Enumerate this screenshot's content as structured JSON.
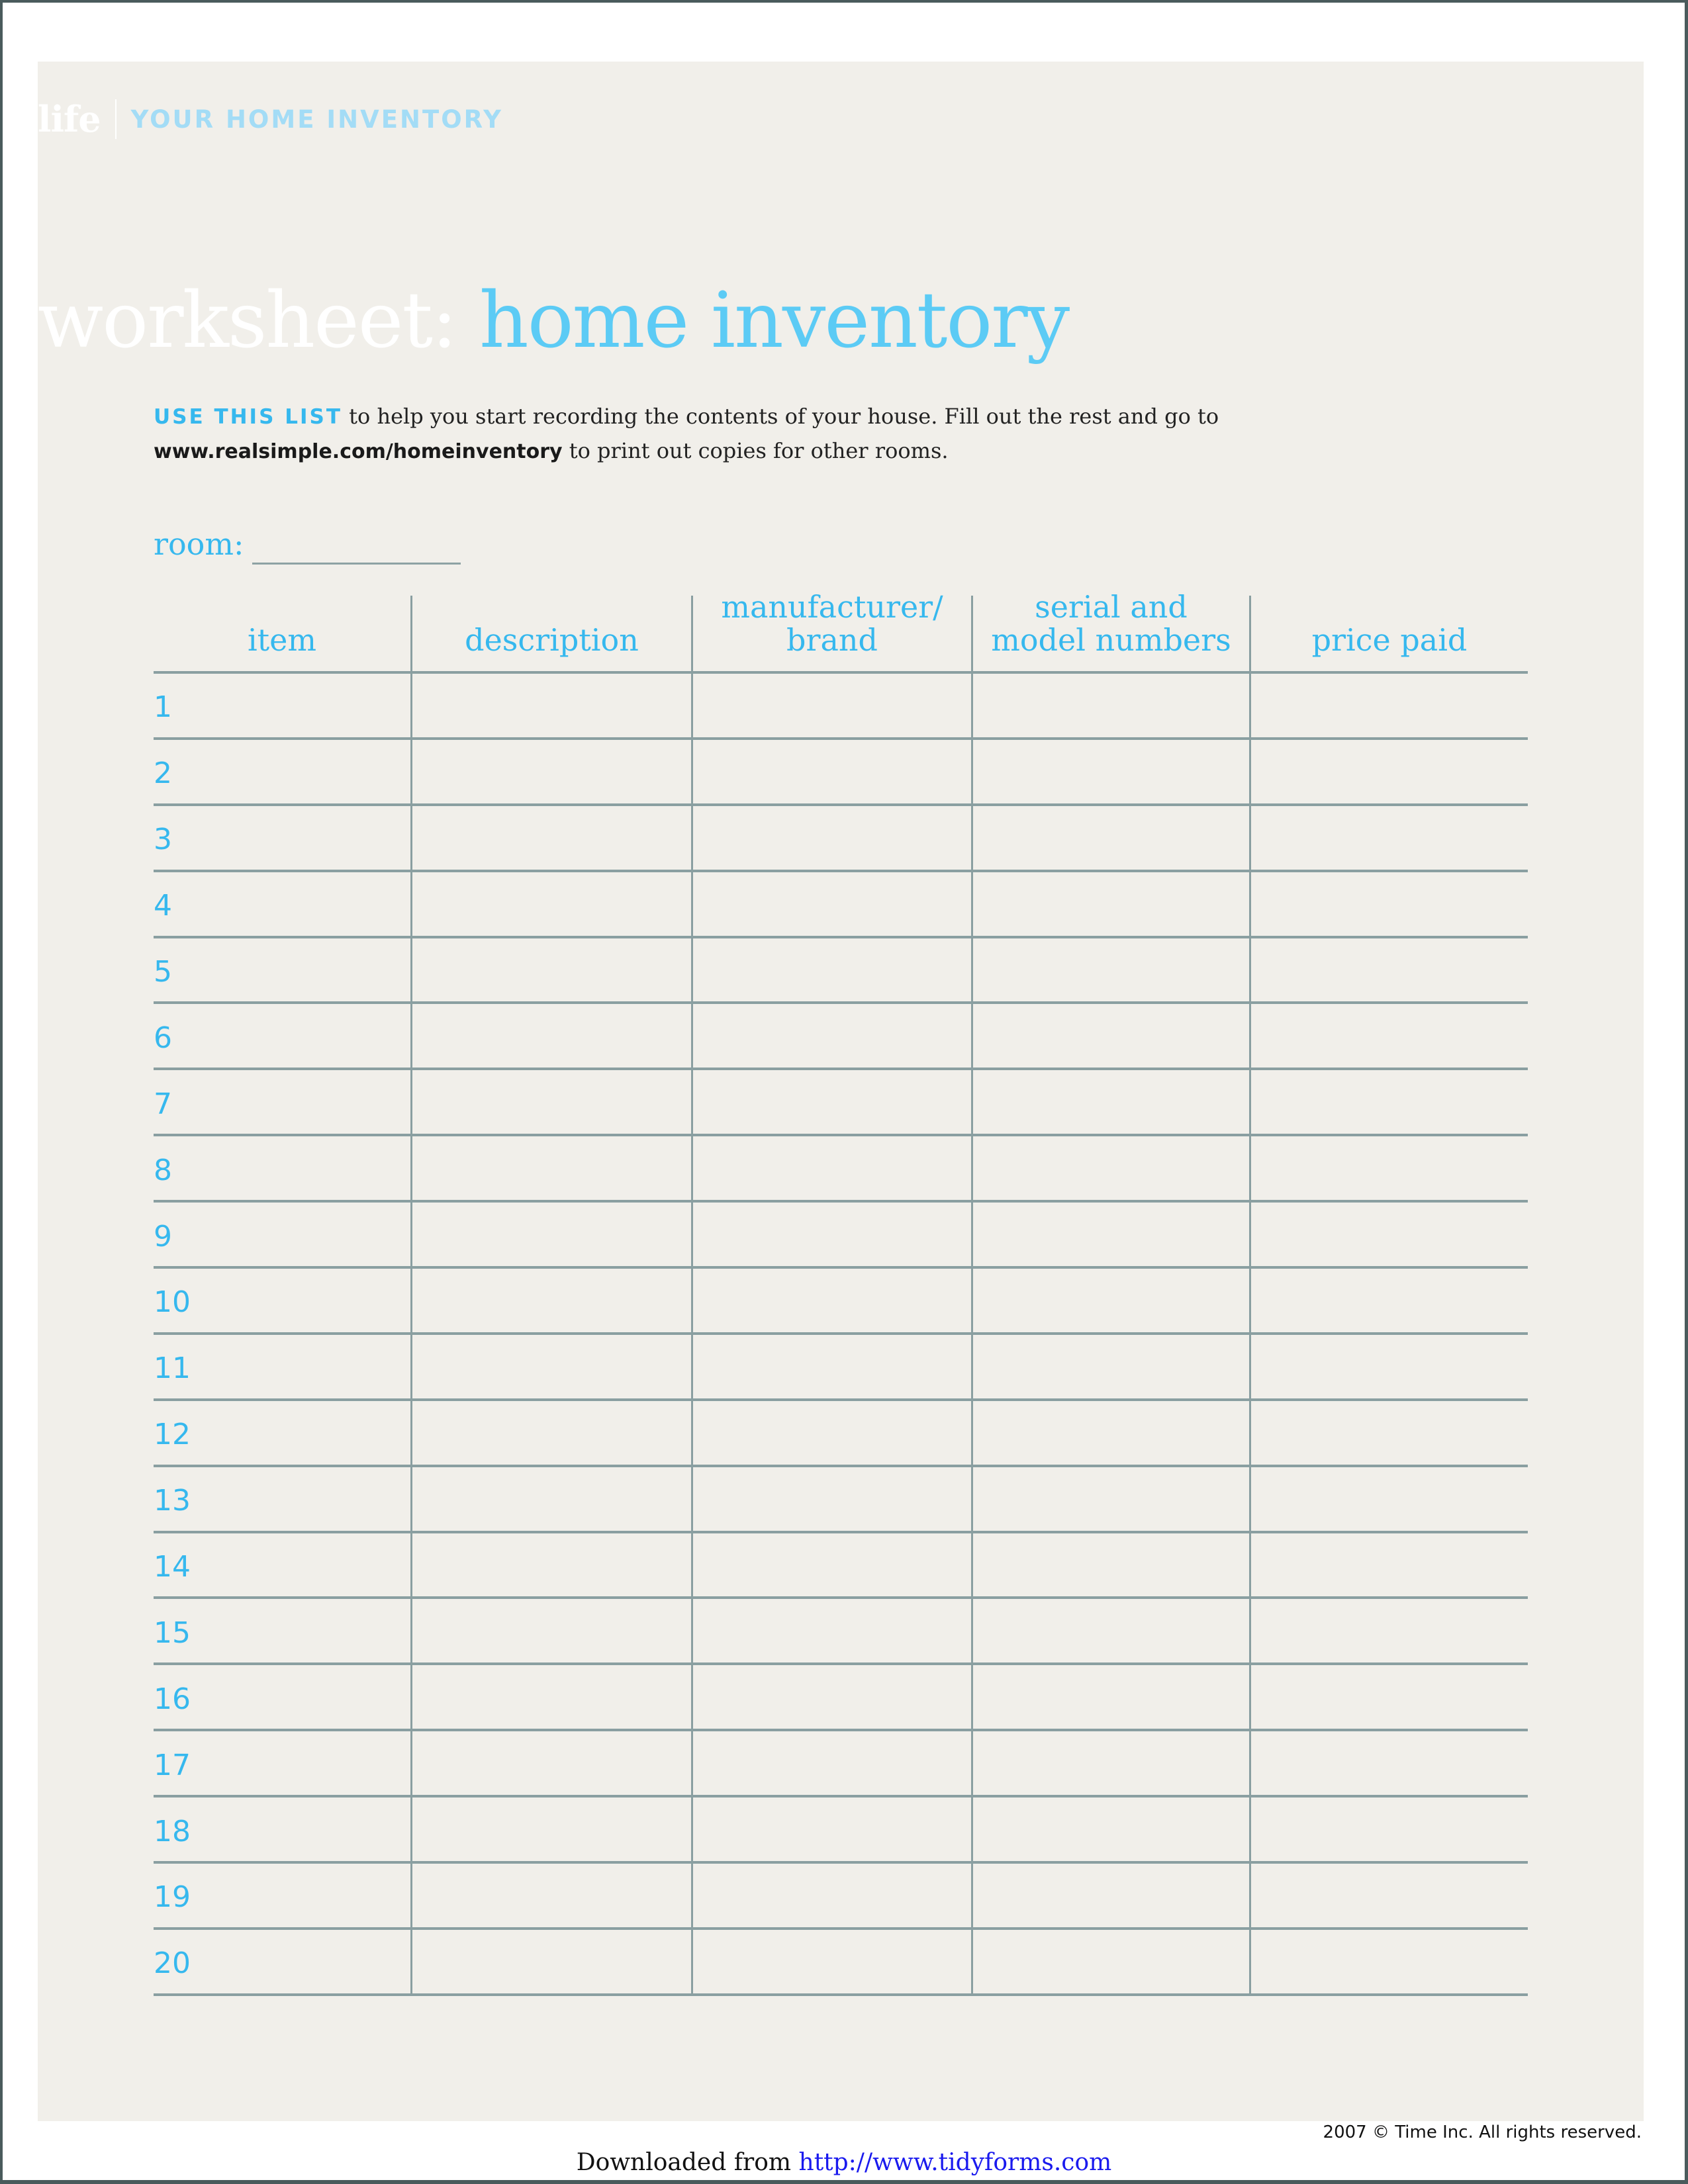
{
  "header": {
    "brand": "life",
    "section": "YOUR HOME INVENTORY"
  },
  "title": {
    "prefix": "worksheet:",
    "main": "home inventory"
  },
  "intro": {
    "lead": "USE THIS LIST",
    "text_before_url": " to help you start recording the contents of your house. Fill out the rest and go to ",
    "url": "www.realsimple.com/homeinventory",
    "text_after_url": " to print out copies for other rooms."
  },
  "room": {
    "label": "room:",
    "value": ""
  },
  "table": {
    "columns": [
      "item",
      "description",
      "manufacturer/\nbrand",
      "serial and\nmodel numbers",
      "price paid"
    ],
    "rows": [
      {
        "number": "1",
        "description": "",
        "manufacturer": "",
        "serial": "",
        "price": ""
      },
      {
        "number": "2",
        "description": "",
        "manufacturer": "",
        "serial": "",
        "price": ""
      },
      {
        "number": "3",
        "description": "",
        "manufacturer": "",
        "serial": "",
        "price": ""
      },
      {
        "number": "4",
        "description": "",
        "manufacturer": "",
        "serial": "",
        "price": ""
      },
      {
        "number": "5",
        "description": "",
        "manufacturer": "",
        "serial": "",
        "price": ""
      },
      {
        "number": "6",
        "description": "",
        "manufacturer": "",
        "serial": "",
        "price": ""
      },
      {
        "number": "7",
        "description": "",
        "manufacturer": "",
        "serial": "",
        "price": ""
      },
      {
        "number": "8",
        "description": "",
        "manufacturer": "",
        "serial": "",
        "price": ""
      },
      {
        "number": "9",
        "description": "",
        "manufacturer": "",
        "serial": "",
        "price": ""
      },
      {
        "number": "10",
        "description": "",
        "manufacturer": "",
        "serial": "",
        "price": ""
      },
      {
        "number": "11",
        "description": "",
        "manufacturer": "",
        "serial": "",
        "price": ""
      },
      {
        "number": "12",
        "description": "",
        "manufacturer": "",
        "serial": "",
        "price": ""
      },
      {
        "number": "13",
        "description": "",
        "manufacturer": "",
        "serial": "",
        "price": ""
      },
      {
        "number": "14",
        "description": "",
        "manufacturer": "",
        "serial": "",
        "price": ""
      },
      {
        "number": "15",
        "description": "",
        "manufacturer": "",
        "serial": "",
        "price": ""
      },
      {
        "number": "16",
        "description": "",
        "manufacturer": "",
        "serial": "",
        "price": ""
      },
      {
        "number": "17",
        "description": "",
        "manufacturer": "",
        "serial": "",
        "price": ""
      },
      {
        "number": "18",
        "description": "",
        "manufacturer": "",
        "serial": "",
        "price": ""
      },
      {
        "number": "19",
        "description": "",
        "manufacturer": "",
        "serial": "",
        "price": ""
      },
      {
        "number": "20",
        "description": "",
        "manufacturer": "",
        "serial": "",
        "price": ""
      }
    ]
  },
  "footer": {
    "copyright": "2007 © Time Inc. All rights reserved.",
    "download_prefix": "Downloaded from ",
    "download_link": "http://www.tidyforms.com"
  },
  "colors": {
    "accent": "#36b8ee",
    "title_accent": "#5ccbf5",
    "panel_background": "#f1efea",
    "rule": "#8a9fa1",
    "link": "#1a1aee"
  }
}
